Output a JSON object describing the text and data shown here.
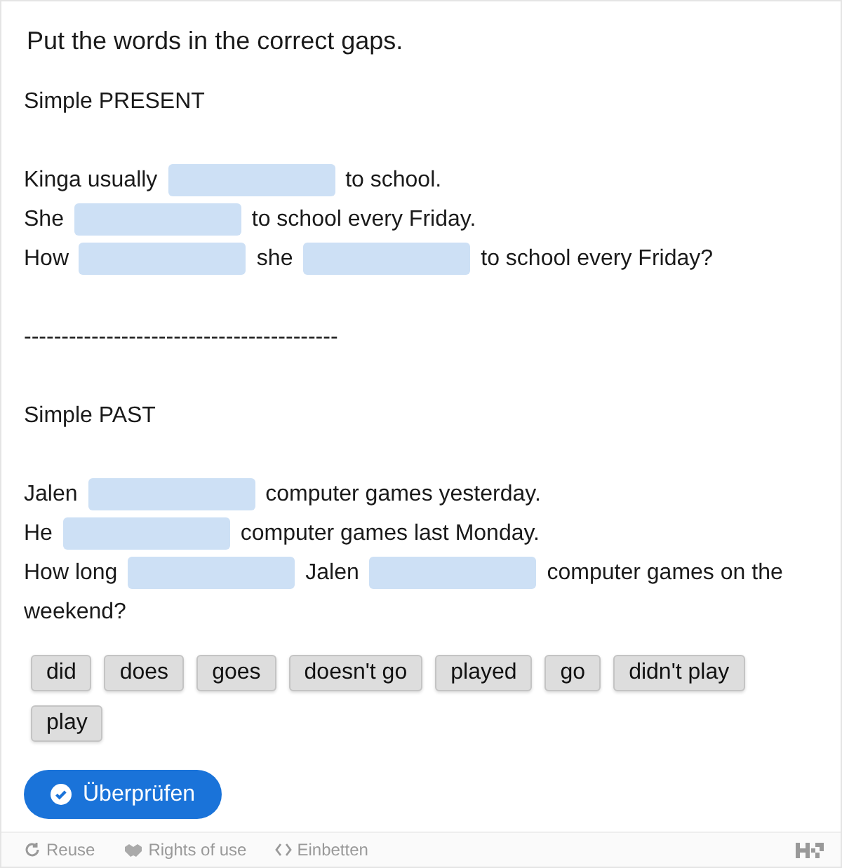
{
  "task": {
    "title": "Put the words in the correct gaps."
  },
  "lines": [
    {
      "kind": "text",
      "parts": [
        {
          "kind": "word",
          "text": "Simple PRESENT"
        }
      ]
    },
    {
      "kind": "empty"
    },
    {
      "kind": "text",
      "parts": [
        {
          "kind": "word",
          "text": "Kinga usually"
        },
        {
          "kind": "gap"
        },
        {
          "kind": "word",
          "text": "to school."
        }
      ]
    },
    {
      "kind": "text",
      "parts": [
        {
          "kind": "word",
          "text": "She"
        },
        {
          "kind": "gap"
        },
        {
          "kind": "word",
          "text": "to school every Friday."
        }
      ]
    },
    {
      "kind": "text",
      "parts": [
        {
          "kind": "word",
          "text": "How"
        },
        {
          "kind": "gap"
        },
        {
          "kind": "word",
          "text": "she"
        },
        {
          "kind": "gap"
        },
        {
          "kind": "word",
          "text": "to school every Friday?"
        }
      ]
    },
    {
      "kind": "empty"
    },
    {
      "kind": "text",
      "parts": [
        {
          "kind": "word",
          "text": "------------------------------------------"
        }
      ]
    },
    {
      "kind": "empty"
    },
    {
      "kind": "text",
      "parts": [
        {
          "kind": "word",
          "text": "Simple PAST"
        }
      ]
    },
    {
      "kind": "empty"
    },
    {
      "kind": "text",
      "parts": [
        {
          "kind": "word",
          "text": "Jalen"
        },
        {
          "kind": "gap"
        },
        {
          "kind": "word",
          "text": "computer games yesterday."
        }
      ]
    },
    {
      "kind": "text",
      "parts": [
        {
          "kind": "word",
          "text": "He"
        },
        {
          "kind": "gap"
        },
        {
          "kind": "word",
          "text": "computer games last Monday."
        }
      ]
    },
    {
      "kind": "text",
      "parts": [
        {
          "kind": "word",
          "text": "How long"
        },
        {
          "kind": "gap"
        },
        {
          "kind": "word",
          "text": "Jalen"
        },
        {
          "kind": "gap"
        },
        {
          "kind": "word",
          "text": "computer games on the"
        },
        {
          "kind": "word",
          "text": "weekend?"
        }
      ]
    }
  ],
  "words": [
    "did",
    "does",
    "goes",
    "doesn't go",
    "played",
    "go",
    "didn't play",
    "play"
  ],
  "check_button": {
    "label": "Überprüfen"
  },
  "footer": {
    "links": [
      {
        "kind": "reuse",
        "label": "Reuse"
      },
      {
        "kind": "rights",
        "label": "Rights of use"
      },
      {
        "kind": "embed",
        "label": "Einbetten"
      }
    ]
  }
}
